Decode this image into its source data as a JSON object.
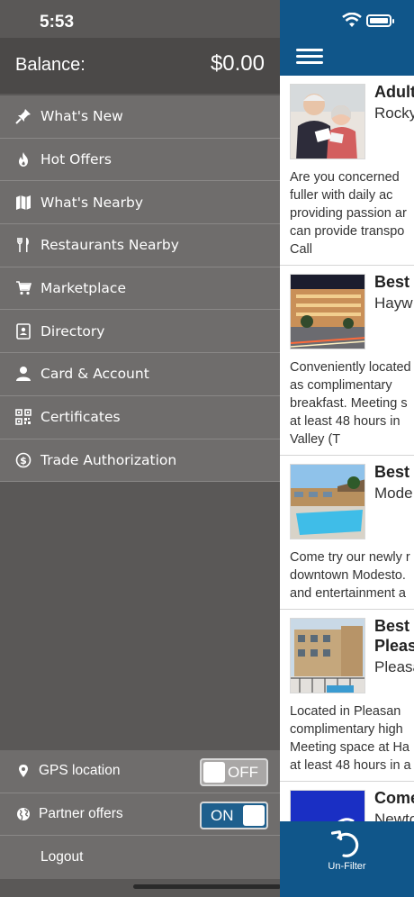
{
  "status_bar": {
    "time": "5:53"
  },
  "drawer": {
    "balance_label": "Balance:",
    "balance_value": "$0.00",
    "menu": [
      {
        "label": "What's New",
        "icon": "pin-icon"
      },
      {
        "label": "Hot Offers",
        "icon": "flame-icon"
      },
      {
        "label": "What's Nearby",
        "icon": "map-icon"
      },
      {
        "label": "Restaurants Nearby",
        "icon": "fork-knife-icon"
      },
      {
        "label": "Marketplace",
        "icon": "cart-icon"
      },
      {
        "label": "Directory",
        "icon": "directory-icon"
      },
      {
        "label": "Card & Account",
        "icon": "user-icon"
      },
      {
        "label": "Certificates",
        "icon": "qr-code-icon"
      },
      {
        "label": "Trade Authorization",
        "icon": "dollar-circle-icon"
      }
    ],
    "gps": {
      "label": "GPS location",
      "state": "OFF"
    },
    "partner": {
      "label": "Partner offers",
      "state": "ON"
    },
    "logout_label": "Logout"
  },
  "listings": [
    {
      "title": "Adult",
      "subtitle": "Rocky",
      "desc": [
        "Are you concerned",
        "fuller with daily ac",
        "providing passion ar",
        "can provide transpo",
        "Call"
      ]
    },
    {
      "title": "Best",
      "subtitle": "Hayw",
      "desc": [
        "Conveniently located",
        "as complimentary",
        "breakfast. Meeting s",
        "at least 48 hours in",
        "Valley (T"
      ]
    },
    {
      "title": "Best",
      "subtitle": "Mode",
      "desc": [
        "Come try our newly r",
        "downtown Modesto.",
        "and entertainment a"
      ]
    },
    {
      "title": "Best",
      "title2": "Pleas",
      "subtitle": "Pleasa",
      "desc": [
        "Located in Pleasan",
        "complimentary high",
        "Meeting space at Ha",
        "at least 48 hours in a"
      ]
    },
    {
      "title": "Come",
      "subtitle": "Newto",
      "desc": []
    }
  ],
  "bottom": {
    "unfilter_label": "Un-Filter"
  },
  "colors": {
    "brand_blue": "#10568a",
    "drawer_bg": "#5a5857",
    "menu_item_bg": "#6f6d6c"
  }
}
